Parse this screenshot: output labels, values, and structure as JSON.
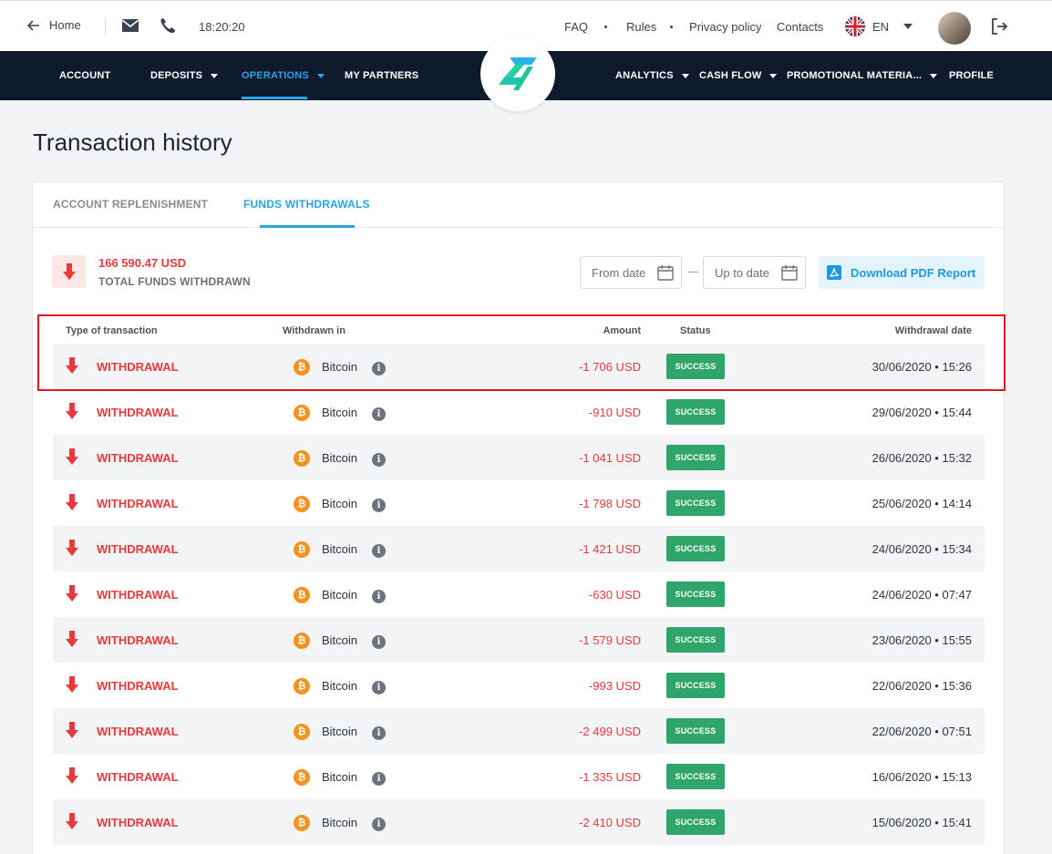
{
  "topbar": {
    "home_label": "Home",
    "time": "18:20:20",
    "links": [
      "FAQ",
      "Rules",
      "Privacy policy",
      "Contacts"
    ],
    "language": "EN"
  },
  "nav": {
    "left": [
      {
        "label": "ACCOUNT",
        "dropdown": false
      },
      {
        "label": "DEPOSITS",
        "dropdown": true
      },
      {
        "label": "OPERATIONS",
        "dropdown": true,
        "active": true
      },
      {
        "label": "MY PARTNERS",
        "dropdown": false
      }
    ],
    "right": [
      {
        "label": "ANALYTICS",
        "dropdown": true
      },
      {
        "label": "CASH FLOW",
        "dropdown": true
      },
      {
        "label": "PROMOTIONAL MATERIA...",
        "dropdown": true
      },
      {
        "label": "PROFILE",
        "dropdown": false
      }
    ]
  },
  "page": {
    "title": "Transaction history"
  },
  "tabs": [
    {
      "label": "ACCOUNT REPLENISHMENT",
      "active": false
    },
    {
      "label": "FUNDS WITHDRAWALS",
      "active": true
    }
  ],
  "summary": {
    "amount": "166 590.47 USD",
    "label": "TOTAL FUNDS WITHDRAWN"
  },
  "filters": {
    "from_placeholder": "From date",
    "to_placeholder": "Up to date",
    "pdf_label": "Download PDF Report"
  },
  "table": {
    "headers": [
      "Type of transaction",
      "Withdrawn in",
      "Amount",
      "Status",
      "Withdrawal date"
    ],
    "rows": [
      {
        "type": "WITHDRAWAL",
        "method": "Bitcoin",
        "amount": "-1 706 USD",
        "status": "SUCCESS",
        "date": "30/06/2020 • 15:26"
      },
      {
        "type": "WITHDRAWAL",
        "method": "Bitcoin",
        "amount": "-910 USD",
        "status": "SUCCESS",
        "date": "29/06/2020 • 15:44"
      },
      {
        "type": "WITHDRAWAL",
        "method": "Bitcoin",
        "amount": "-1 041 USD",
        "status": "SUCCESS",
        "date": "26/06/2020 • 15:32"
      },
      {
        "type": "WITHDRAWAL",
        "method": "Bitcoin",
        "amount": "-1 798 USD",
        "status": "SUCCESS",
        "date": "25/06/2020 • 14:14"
      },
      {
        "type": "WITHDRAWAL",
        "method": "Bitcoin",
        "amount": "-1 421 USD",
        "status": "SUCCESS",
        "date": "24/06/2020 • 15:34"
      },
      {
        "type": "WITHDRAWAL",
        "method": "Bitcoin",
        "amount": "-630 USD",
        "status": "SUCCESS",
        "date": "24/06/2020 • 07:47"
      },
      {
        "type": "WITHDRAWAL",
        "method": "Bitcoin",
        "amount": "-1 579 USD",
        "status": "SUCCESS",
        "date": "23/06/2020 • 15:55"
      },
      {
        "type": "WITHDRAWAL",
        "method": "Bitcoin",
        "amount": "-993 USD",
        "status": "SUCCESS",
        "date": "22/06/2020 • 15:36"
      },
      {
        "type": "WITHDRAWAL",
        "method": "Bitcoin",
        "amount": "-2 499 USD",
        "status": "SUCCESS",
        "date": "22/06/2020 • 07:51"
      },
      {
        "type": "WITHDRAWAL",
        "method": "Bitcoin",
        "amount": "-1 335 USD",
        "status": "SUCCESS",
        "date": "16/06/2020 • 15:13"
      },
      {
        "type": "WITHDRAWAL",
        "method": "Bitcoin",
        "amount": "-2 410 USD",
        "status": "SUCCESS",
        "date": "15/06/2020 • 15:41"
      }
    ]
  },
  "colors": {
    "accent": "#28a5e6",
    "negative": "#e83a3a",
    "success": "#2fa56b",
    "nav_bg": "#0f1b2d",
    "highlight": "#e0181e"
  }
}
